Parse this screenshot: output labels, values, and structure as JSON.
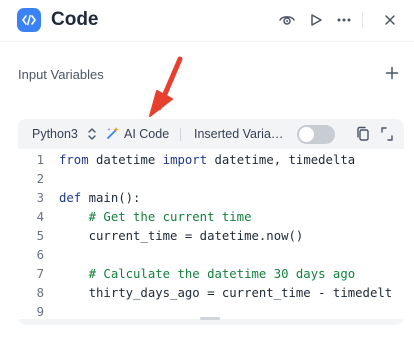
{
  "header": {
    "title": "Code",
    "icons": [
      "code-icon",
      "eye-icon",
      "play-icon",
      "more-icon",
      "close-icon"
    ]
  },
  "input_variables": {
    "label": "Input Variables"
  },
  "editor": {
    "language": "Python3",
    "ai_label": "AI Code",
    "inserted_label": "Inserted Varia…",
    "toggle_on": false,
    "lines": [
      {
        "num": "1",
        "segs": [
          {
            "t": "from",
            "c": "kw"
          },
          {
            "t": " datetime ",
            "c": ""
          },
          {
            "t": "import",
            "c": "kw"
          },
          {
            "t": " datetime, timedelta",
            "c": ""
          }
        ]
      },
      {
        "num": "2",
        "segs": []
      },
      {
        "num": "3",
        "segs": [
          {
            "t": "def",
            "c": "kw"
          },
          {
            "t": " main():",
            "c": ""
          }
        ]
      },
      {
        "num": "4",
        "segs": [
          {
            "t": "    # Get the current time",
            "c": "cm"
          }
        ]
      },
      {
        "num": "5",
        "segs": [
          {
            "t": "    current_time = datetime.now()",
            "c": ""
          }
        ]
      },
      {
        "num": "6",
        "segs": []
      },
      {
        "num": "7",
        "segs": [
          {
            "t": "    # Calculate the datetime 30 days ago",
            "c": "cm"
          }
        ]
      },
      {
        "num": "8",
        "segs": [
          {
            "t": "    thirty_days_ago = current_time - timedelt",
            "c": ""
          }
        ]
      },
      {
        "num": "9",
        "segs": []
      }
    ]
  },
  "colors": {
    "accent": "#3b82f6",
    "arrow": "#e8402e",
    "keyword": "#1e3a8a",
    "comment": "#15803d"
  }
}
